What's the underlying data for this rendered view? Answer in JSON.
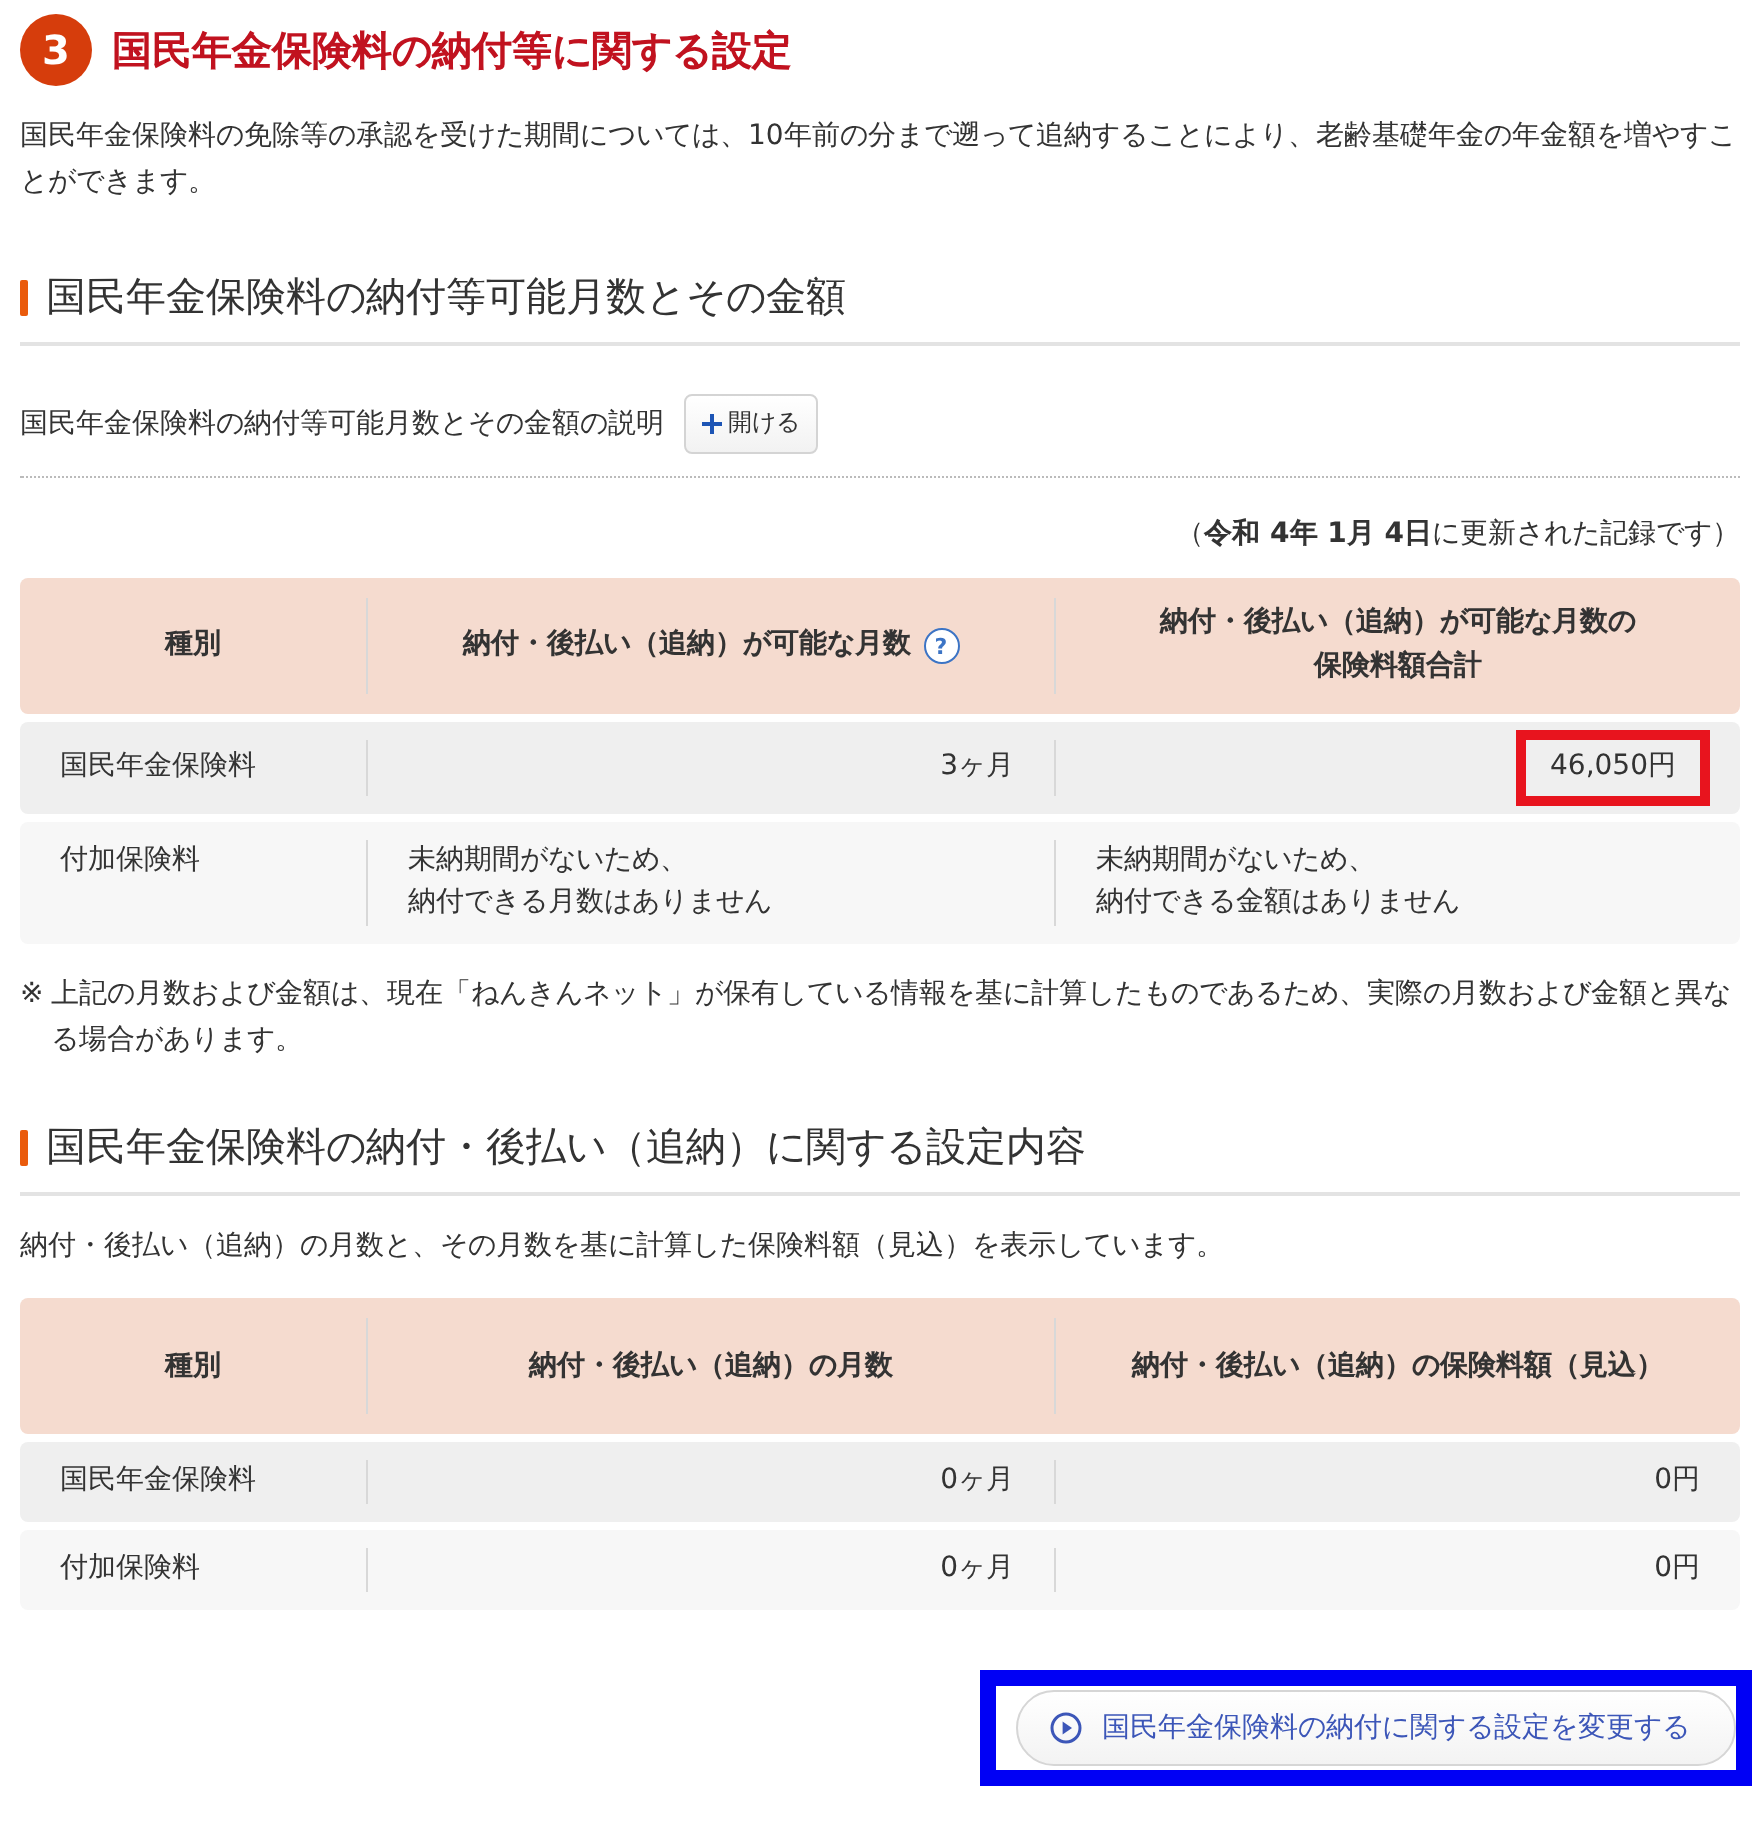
{
  "section": {
    "number": "3",
    "title": "国民年金保険料の納付等に関する設定"
  },
  "intro": "国民年金保険料の免除等の承認を受けた期間については、10年前の分まで遡って追納することにより、老齢基礎年金の年金額を増やすことができます。",
  "available": {
    "heading": "国民年金保険料の納付等可能月数とその金額",
    "explain_label": "国民年金保険料の納付等可能月数とその金額の説明",
    "open_button": {
      "label": "開ける"
    },
    "updated_note": "（**令和 4年 1月 4日**に更新された記録です）",
    "table": {
      "columns": [
        {
          "label": "種別"
        },
        {
          "label": "納付・後払い（追納）が可能な月数",
          "help": "?"
        },
        {
          "lines": [
            "納付・後払い（追納）が可能な月数の",
            "保険料額合計"
          ]
        }
      ],
      "rows": [
        {
          "cells": [
            {
              "kind": "label",
              "text": "国民年金保険料"
            },
            {
              "kind": "number",
              "text": "3ヶ月"
            },
            {
              "kind": "number",
              "text": "46,050円",
              "highlighted": true
            }
          ]
        },
        {
          "cells": [
            {
              "kind": "label",
              "text": "付加保険料"
            },
            {
              "kind": "note",
              "lines": [
                "未納期間がないため、",
                "納付できる月数はありません"
              ]
            },
            {
              "kind": "note",
              "lines": [
                "未納期間がないため、",
                "納付できる金額はありません"
              ]
            }
          ]
        }
      ]
    },
    "footnote": {
      "mark": "※",
      "text": "上記の月数および金額は、現在「ねんきんネット」が保有している情報を基に計算したものであるため、実際の月数および金額と異なる場合があります。"
    }
  },
  "settings": {
    "heading": "国民年金保険料の納付・後払い（追納）に関する設定内容",
    "description": "納付・後払い（追納）の月数と、その月数を基に計算した保険料額（見込）を表示しています。",
    "table": {
      "columns": [
        {
          "label": "種別"
        },
        {
          "label": "納付・後払い（追納）の月数"
        },
        {
          "label": "納付・後払い（追納）の保険料額（見込）"
        }
      ],
      "rows": [
        {
          "cells": [
            {
              "kind": "label",
              "text": "国民年金保険料"
            },
            {
              "kind": "number",
              "text": "0ヶ月"
            },
            {
              "kind": "number",
              "text": "0円"
            }
          ]
        },
        {
          "cells": [
            {
              "kind": "label",
              "text": "付加保険料"
            },
            {
              "kind": "number",
              "text": "0ヶ月"
            },
            {
              "kind": "number",
              "text": "0円"
            }
          ]
        }
      ]
    }
  },
  "change_button": {
    "label": "国民年金保険料の納付に関する設定を変更する",
    "highlighted": true
  }
}
